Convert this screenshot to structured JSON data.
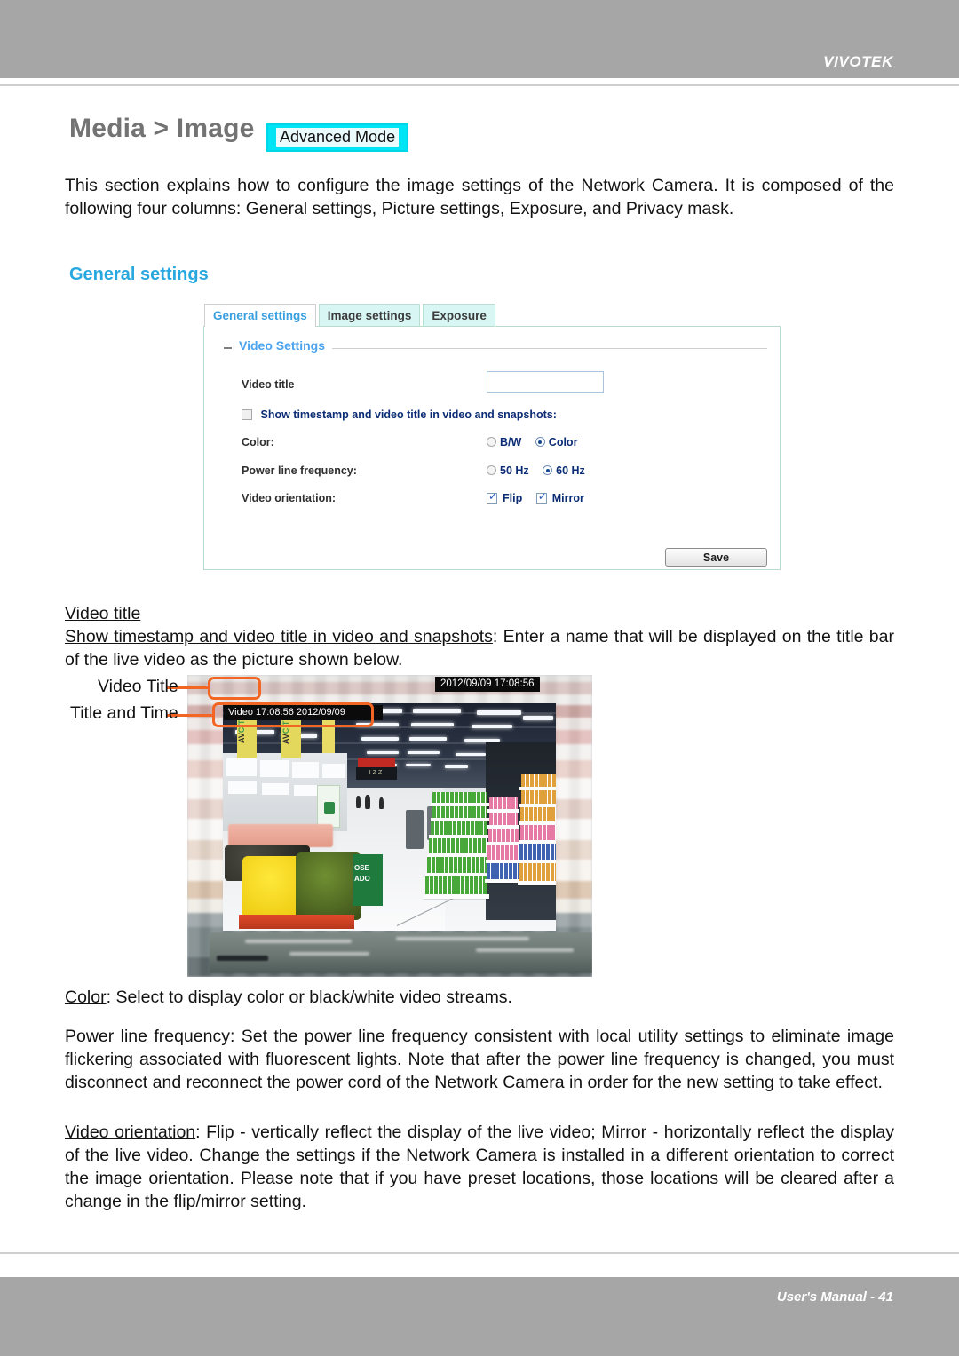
{
  "header": {
    "brand": "VIVOTEK"
  },
  "title": {
    "text": "Media > Image",
    "badge": "Advanced Mode"
  },
  "intro": "This section explains how to configure the image settings of the Network Camera. It is composed of the following four columns: General settings, Picture settings, Exposure, and Privacy mask.",
  "section_heading": "General settings",
  "panel": {
    "tabs": [
      {
        "label": "General settings",
        "active": true
      },
      {
        "label": "Image settings",
        "active": false
      },
      {
        "label": "Exposure",
        "active": false
      }
    ],
    "legend": "Video Settings",
    "fields": {
      "video_title_label": "Video title",
      "video_title_value": "",
      "show_timestamp_label": "Show timestamp and video title in video and snapshots:",
      "show_timestamp_checked": false,
      "color_label": "Color:",
      "color_options": [
        {
          "label": "B/W",
          "selected": false
        },
        {
          "label": "Color",
          "selected": true
        }
      ],
      "power_line_label": "Power line frequency:",
      "power_line_options": [
        {
          "label": "50 Hz",
          "selected": false
        },
        {
          "label": "60 Hz",
          "selected": true
        }
      ],
      "orientation_label": "Video orientation:",
      "orientation_options": [
        {
          "label": "Flip",
          "checked": true
        },
        {
          "label": "Mirror",
          "checked": true
        }
      ]
    },
    "save_label": "Save"
  },
  "definitions": {
    "video_title_term": "Video title",
    "show_timestamp_term": "Show timestamp and video title in video and snapshots",
    "show_timestamp_desc": ": Enter a name that will be displayed on the title bar of the live video as the picture shown below.",
    "color_term": "Color",
    "color_desc": ": Select to display color or black/white video streams.",
    "power_term": "Power line frequency",
    "power_desc": ": Set the power line frequency consistent with local utility settings to eliminate image flickering associated with fluorescent lights. Note that after the power line frequency is changed, you must disconnect and reconnect the power cord of the Network Camera in order for the new setting to take effect.",
    "orientation_term": "Video orientation",
    "orientation_desc": ": Flip - vertically reflect the display of the live video; Mirror - horizontally reflect the display of the live video. Change the settings if the Network Camera is installed in a different orientation to correct the image orientation. Please note that if you have preset locations, those locations will be cleared after a change in the flip/mirror setting."
  },
  "figure": {
    "callout_video_title": "Video Title",
    "callout_title_and_time": "Title and Time",
    "timestamp_overlay": "2012/09/09  17:08:56",
    "title_time_overlay": "Video 17:08:56  2012/09/09",
    "accent_color": "#f26522",
    "scene_labels": {
      "banner_a": "AV",
      "banner_b": "CIT",
      "green_sign": "OSE ADO",
      "black_sign": "IZZ"
    }
  },
  "footer": {
    "text": "User's Manual - 41"
  }
}
